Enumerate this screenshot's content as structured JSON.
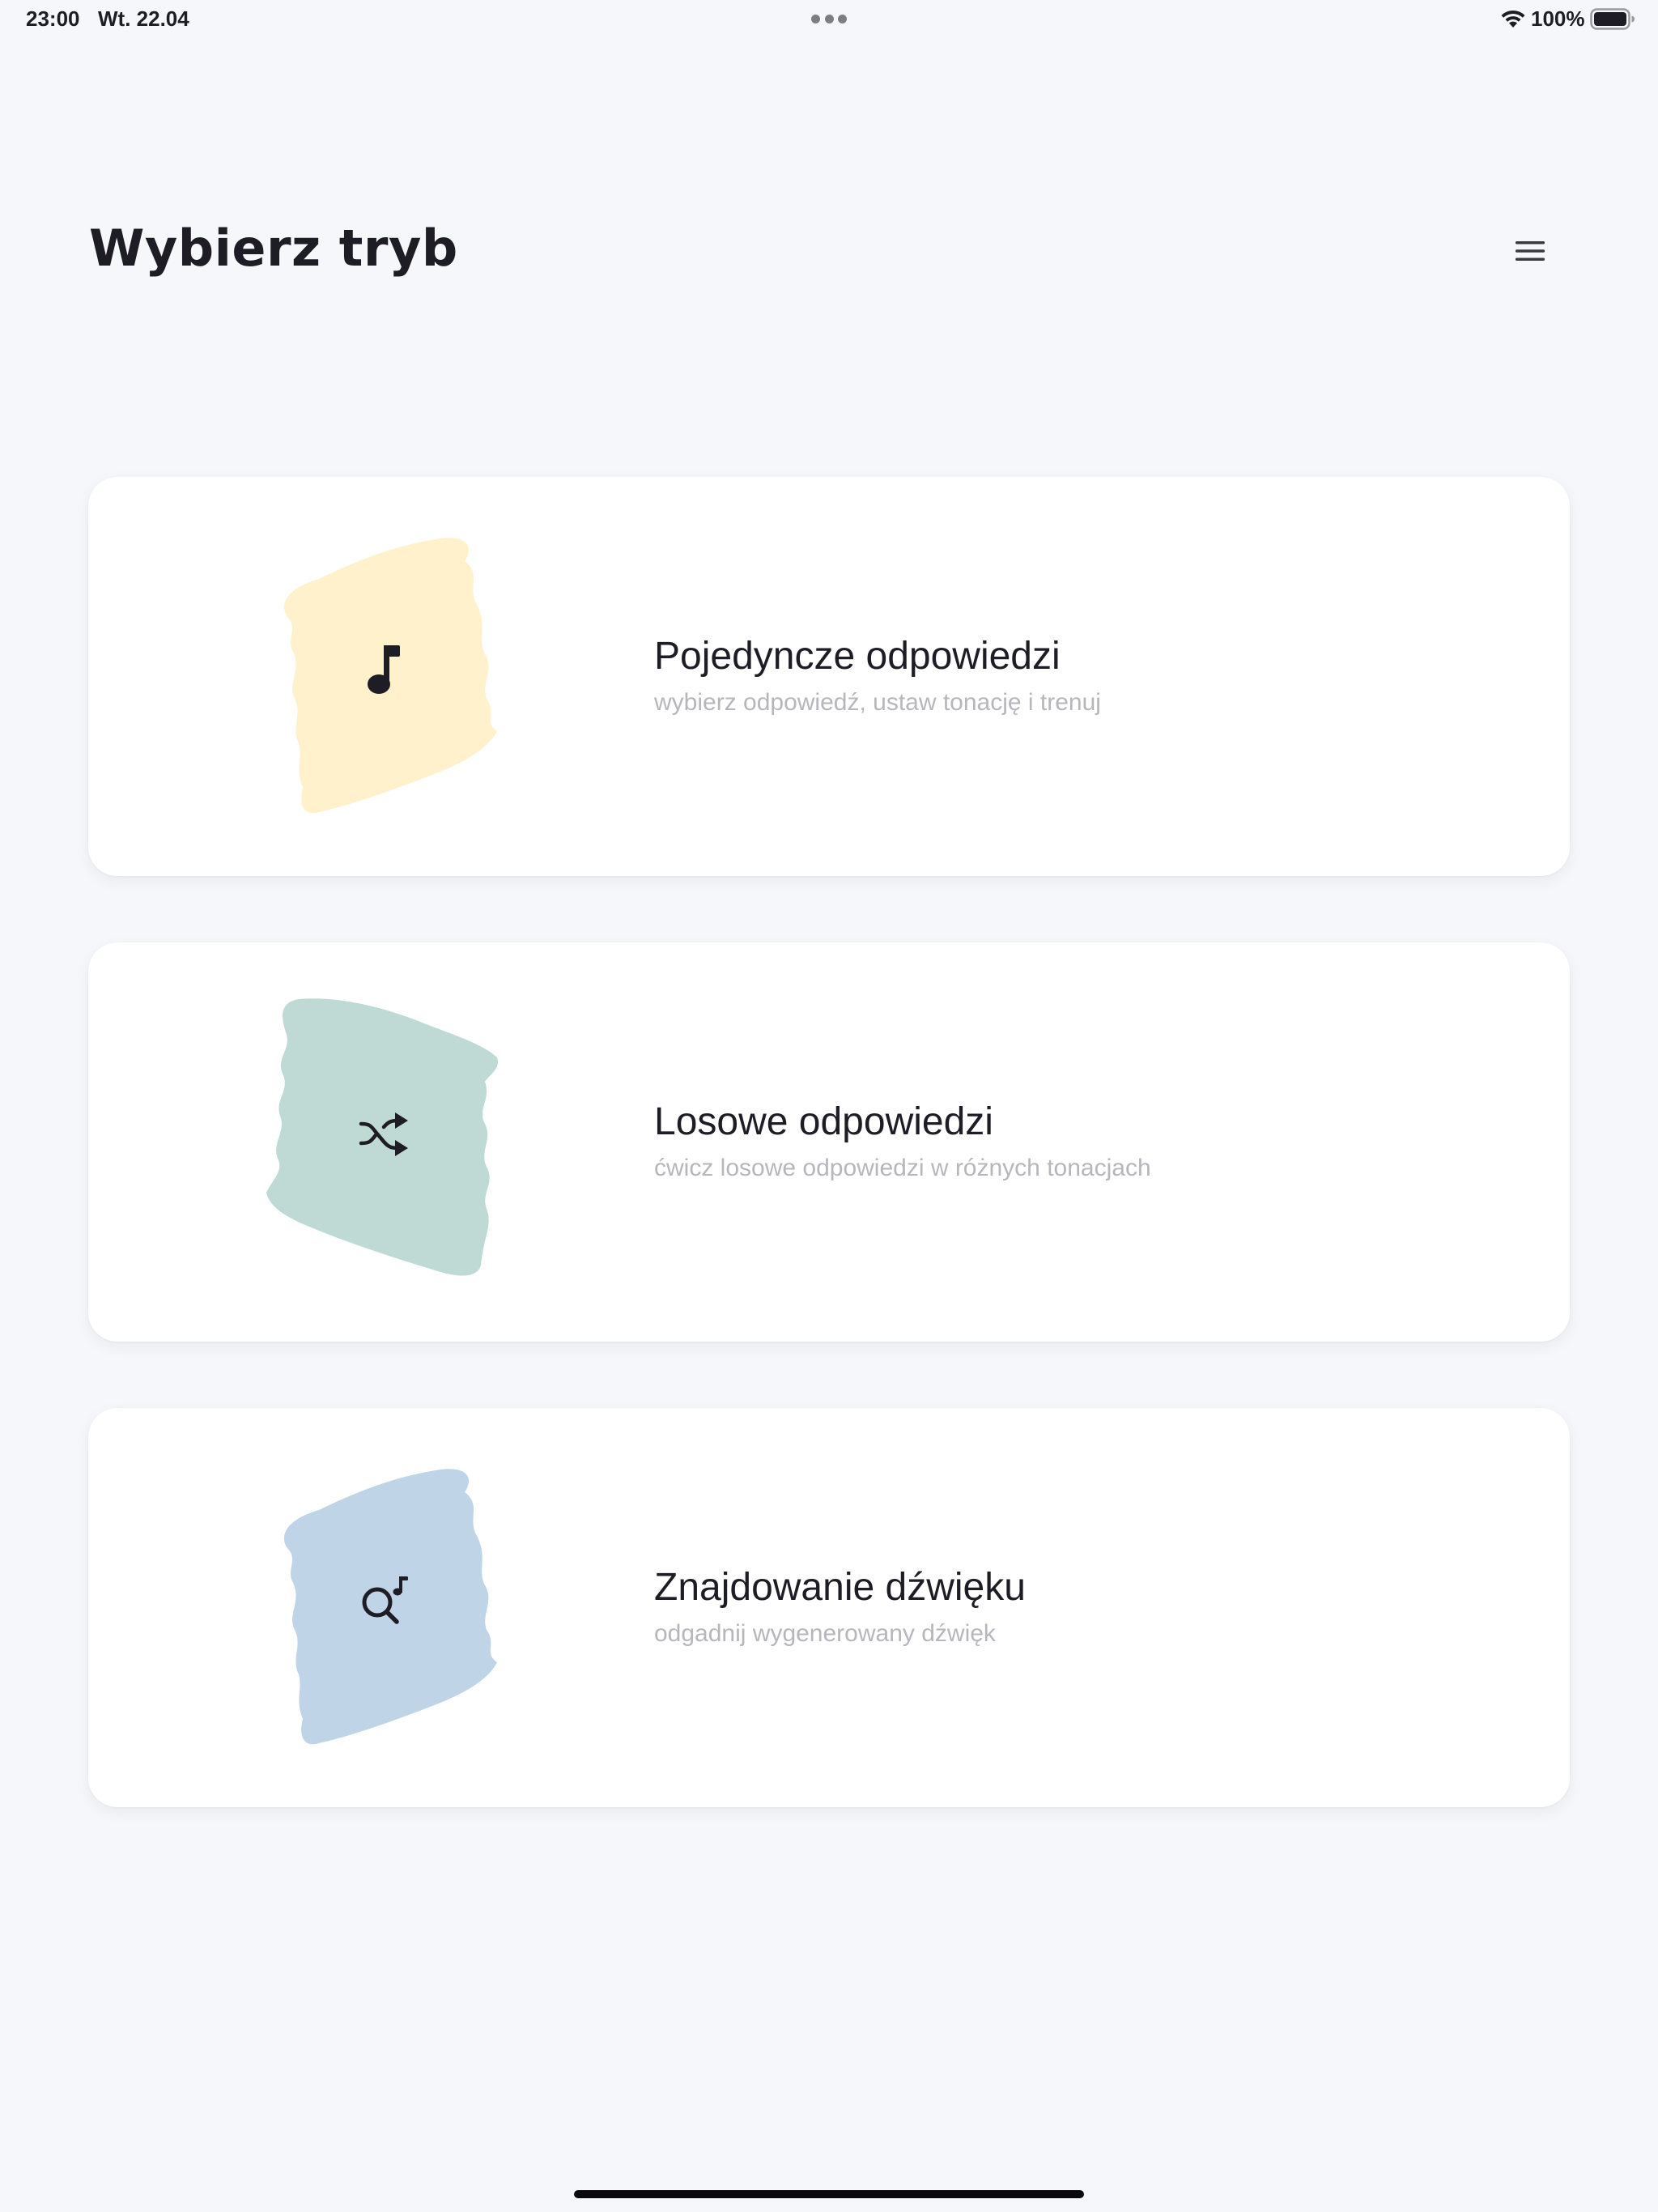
{
  "status_bar": {
    "time": "23:00",
    "date": "Wt. 22.04",
    "battery": "100%",
    "wifi_icon": "wifi-icon",
    "battery_icon": "battery-full-icon"
  },
  "header": {
    "title": "Wybierz tryb",
    "menu_icon": "hamburger-menu-icon"
  },
  "modes": [
    {
      "title": "Pojedyncze odpowiedzi",
      "subtitle": "wybierz odpowiedź, ustaw tonację i trenuj",
      "icon": "music-note-icon",
      "blob_color": "#FEF1CC"
    },
    {
      "title": "Losowe odpowiedzi",
      "subtitle": "ćwicz losowe odpowiedzi w różnych tonacjach",
      "icon": "shuffle-icon",
      "blob_color": "#BFDAD5"
    },
    {
      "title": "Znajdowanie dźwięku",
      "subtitle": "odgadnij wygenerowany dźwięk",
      "icon": "search-music-icon",
      "blob_color": "#C0D4E8"
    }
  ],
  "colors": {
    "background": "#F6F7FB",
    "card": "#FFFFFF",
    "text_primary": "#1E1C24",
    "text_secondary": "#B6B6BC"
  }
}
